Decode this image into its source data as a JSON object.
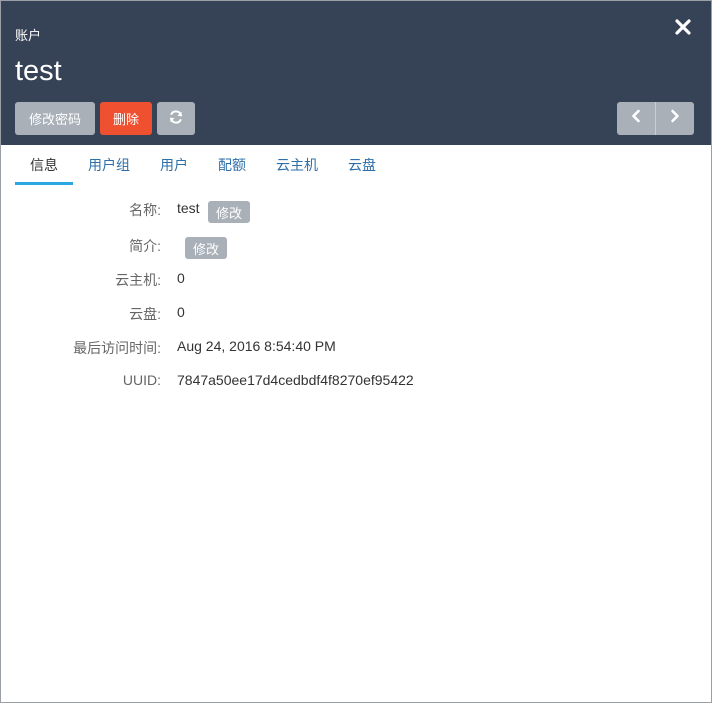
{
  "header": {
    "section_label": "账户",
    "title": "test",
    "buttons": {
      "change_password": "修改密码",
      "delete": "删除"
    },
    "icons": {
      "close": "close-icon",
      "refresh": "refresh-icon",
      "prev": "chevron-left-icon",
      "next": "chevron-right-icon"
    }
  },
  "tabs": [
    {
      "label": "信息",
      "active": true
    },
    {
      "label": "用户组",
      "active": false
    },
    {
      "label": "用户",
      "active": false
    },
    {
      "label": "配额",
      "active": false
    },
    {
      "label": "云主机",
      "active": false
    },
    {
      "label": "云盘",
      "active": false
    }
  ],
  "info": {
    "name": {
      "label": "名称:",
      "value": "test",
      "edit": "修改"
    },
    "description": {
      "label": "简介:",
      "value": "",
      "edit": "修改"
    },
    "vm_count": {
      "label": "云主机:",
      "value": "0"
    },
    "volume_count": {
      "label": "云盘:",
      "value": "0"
    },
    "last_access": {
      "label": "最后访问时间:",
      "value": "Aug 24, 2016 8:54:40 PM"
    },
    "uuid": {
      "label": "UUID:",
      "value": "7847a50ee17d4cedbdf4f8270ef95422"
    }
  },
  "colors": {
    "header_bg": "#364256",
    "danger": "#ef5130",
    "button_gray": "#a9b0b8",
    "tab_active_underline": "#2ba6e1",
    "tab_link": "#2e6fa8"
  }
}
